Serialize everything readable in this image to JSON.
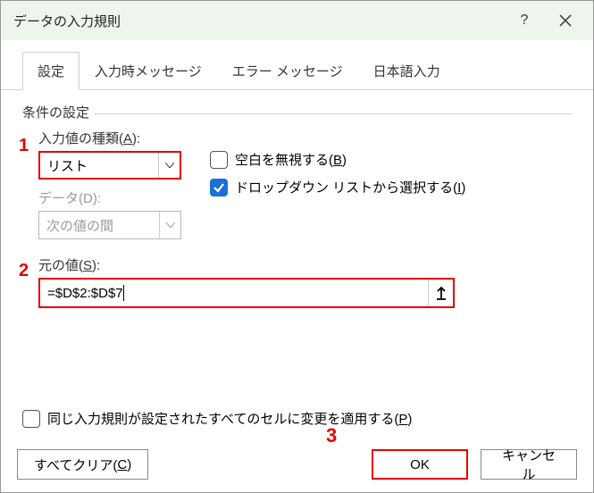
{
  "window": {
    "title": "データの入力規則",
    "help": "?",
    "close": "×"
  },
  "tabs": {
    "settings": "設定",
    "input_msg": "入力時メッセージ",
    "error_msg": "エラー メッセージ",
    "ime": "日本語入力"
  },
  "fieldset": {
    "criteria": "条件の設定"
  },
  "allow": {
    "label_pre": "入力値の種類(",
    "label_key": "A",
    "label_post": "):",
    "value": "リスト"
  },
  "data_field": {
    "label": "データ(D):",
    "value": "次の値の間"
  },
  "cb_ignore_blank": {
    "label_pre": "空白を無視する(",
    "label_key": "B",
    "label_post": ")"
  },
  "cb_dropdown": {
    "label_pre": "ドロップダウン リストから選択する(",
    "label_key": "I",
    "label_post": ")"
  },
  "source": {
    "label_pre": "元の値(",
    "label_key": "S",
    "label_post": "):",
    "value": "=$D$2:$D$7"
  },
  "apply_all": {
    "label_pre": "同じ入力規則が設定されたすべてのセルに変更を適用する(",
    "label_key": "P",
    "label_post": ")"
  },
  "buttons": {
    "clear_pre": "すべてクリア(",
    "clear_key": "C",
    "clear_post": ")",
    "ok": "OK",
    "cancel": "キャンセル"
  },
  "annot": {
    "n1": "1",
    "n2": "2",
    "n3": "3"
  }
}
